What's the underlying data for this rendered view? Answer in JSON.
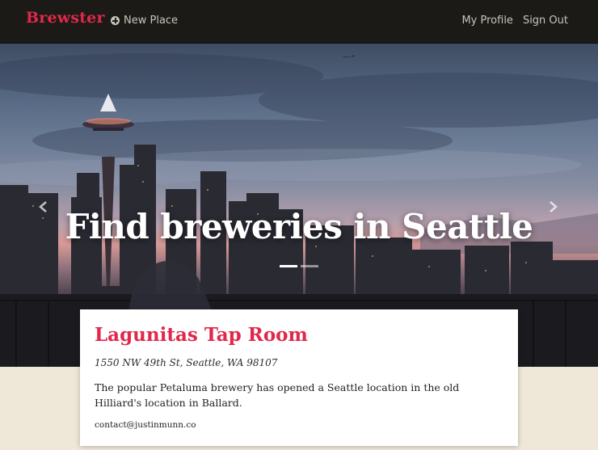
{
  "navbar": {
    "brand": "Brewster",
    "new_place_label": "New Place",
    "new_place_icon": "plus-circle-icon",
    "links": [
      "My Profile",
      "Sign Out"
    ]
  },
  "hero": {
    "title": "Find breweries in Seattle",
    "prev_icon": "chevron-left-icon",
    "next_icon": "chevron-right-icon",
    "slide_count": 2,
    "active_slide": 1
  },
  "place": {
    "name": "Lagunitas Tap Room",
    "address": "1550 NW 49th St, Seattle, WA 98107",
    "description": "The popular Petaluma brewery has opened a Seattle location in the old Hilliard's location in Ballard.",
    "email": "contact@justinmunn.co"
  },
  "colors": {
    "accent": "#e0294a",
    "navbar_bg": "#1c1a17",
    "page_bg": "#efe8d8"
  }
}
